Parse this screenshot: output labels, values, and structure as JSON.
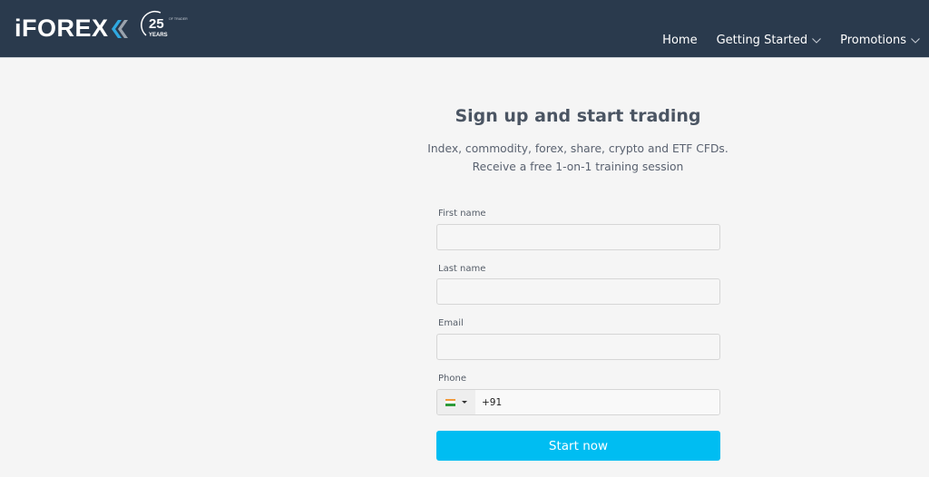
{
  "header": {
    "logo_text": "iFOREX",
    "badge": {
      "number": "25",
      "years": "YEARS",
      "tagline": "OF TRADER TRUST"
    },
    "nav": [
      {
        "label": "Home",
        "has_dropdown": false
      },
      {
        "label": "Getting Started",
        "has_dropdown": true
      },
      {
        "label": "Promotions",
        "has_dropdown": true
      }
    ]
  },
  "signup": {
    "title": "Sign up and start trading",
    "subtitle_line1": "Index, commodity, forex, share, crypto and ETF CFDs.",
    "subtitle_line2": "Receive a free 1-on-1 training session",
    "fields": {
      "first_name": {
        "label": "First name",
        "value": ""
      },
      "last_name": {
        "label": "Last name",
        "value": ""
      },
      "email": {
        "label": "Email",
        "value": ""
      },
      "phone": {
        "label": "Phone",
        "country": "India",
        "value": "+91"
      }
    },
    "submit_label": "Start now"
  },
  "colors": {
    "header_bg": "#2a3a4d",
    "page_bg": "#f5f5f5",
    "accent": "#00bdf2",
    "logo_arrow_blue": "#2fa8e0",
    "logo_arrow_gray": "#9aa3ad"
  }
}
